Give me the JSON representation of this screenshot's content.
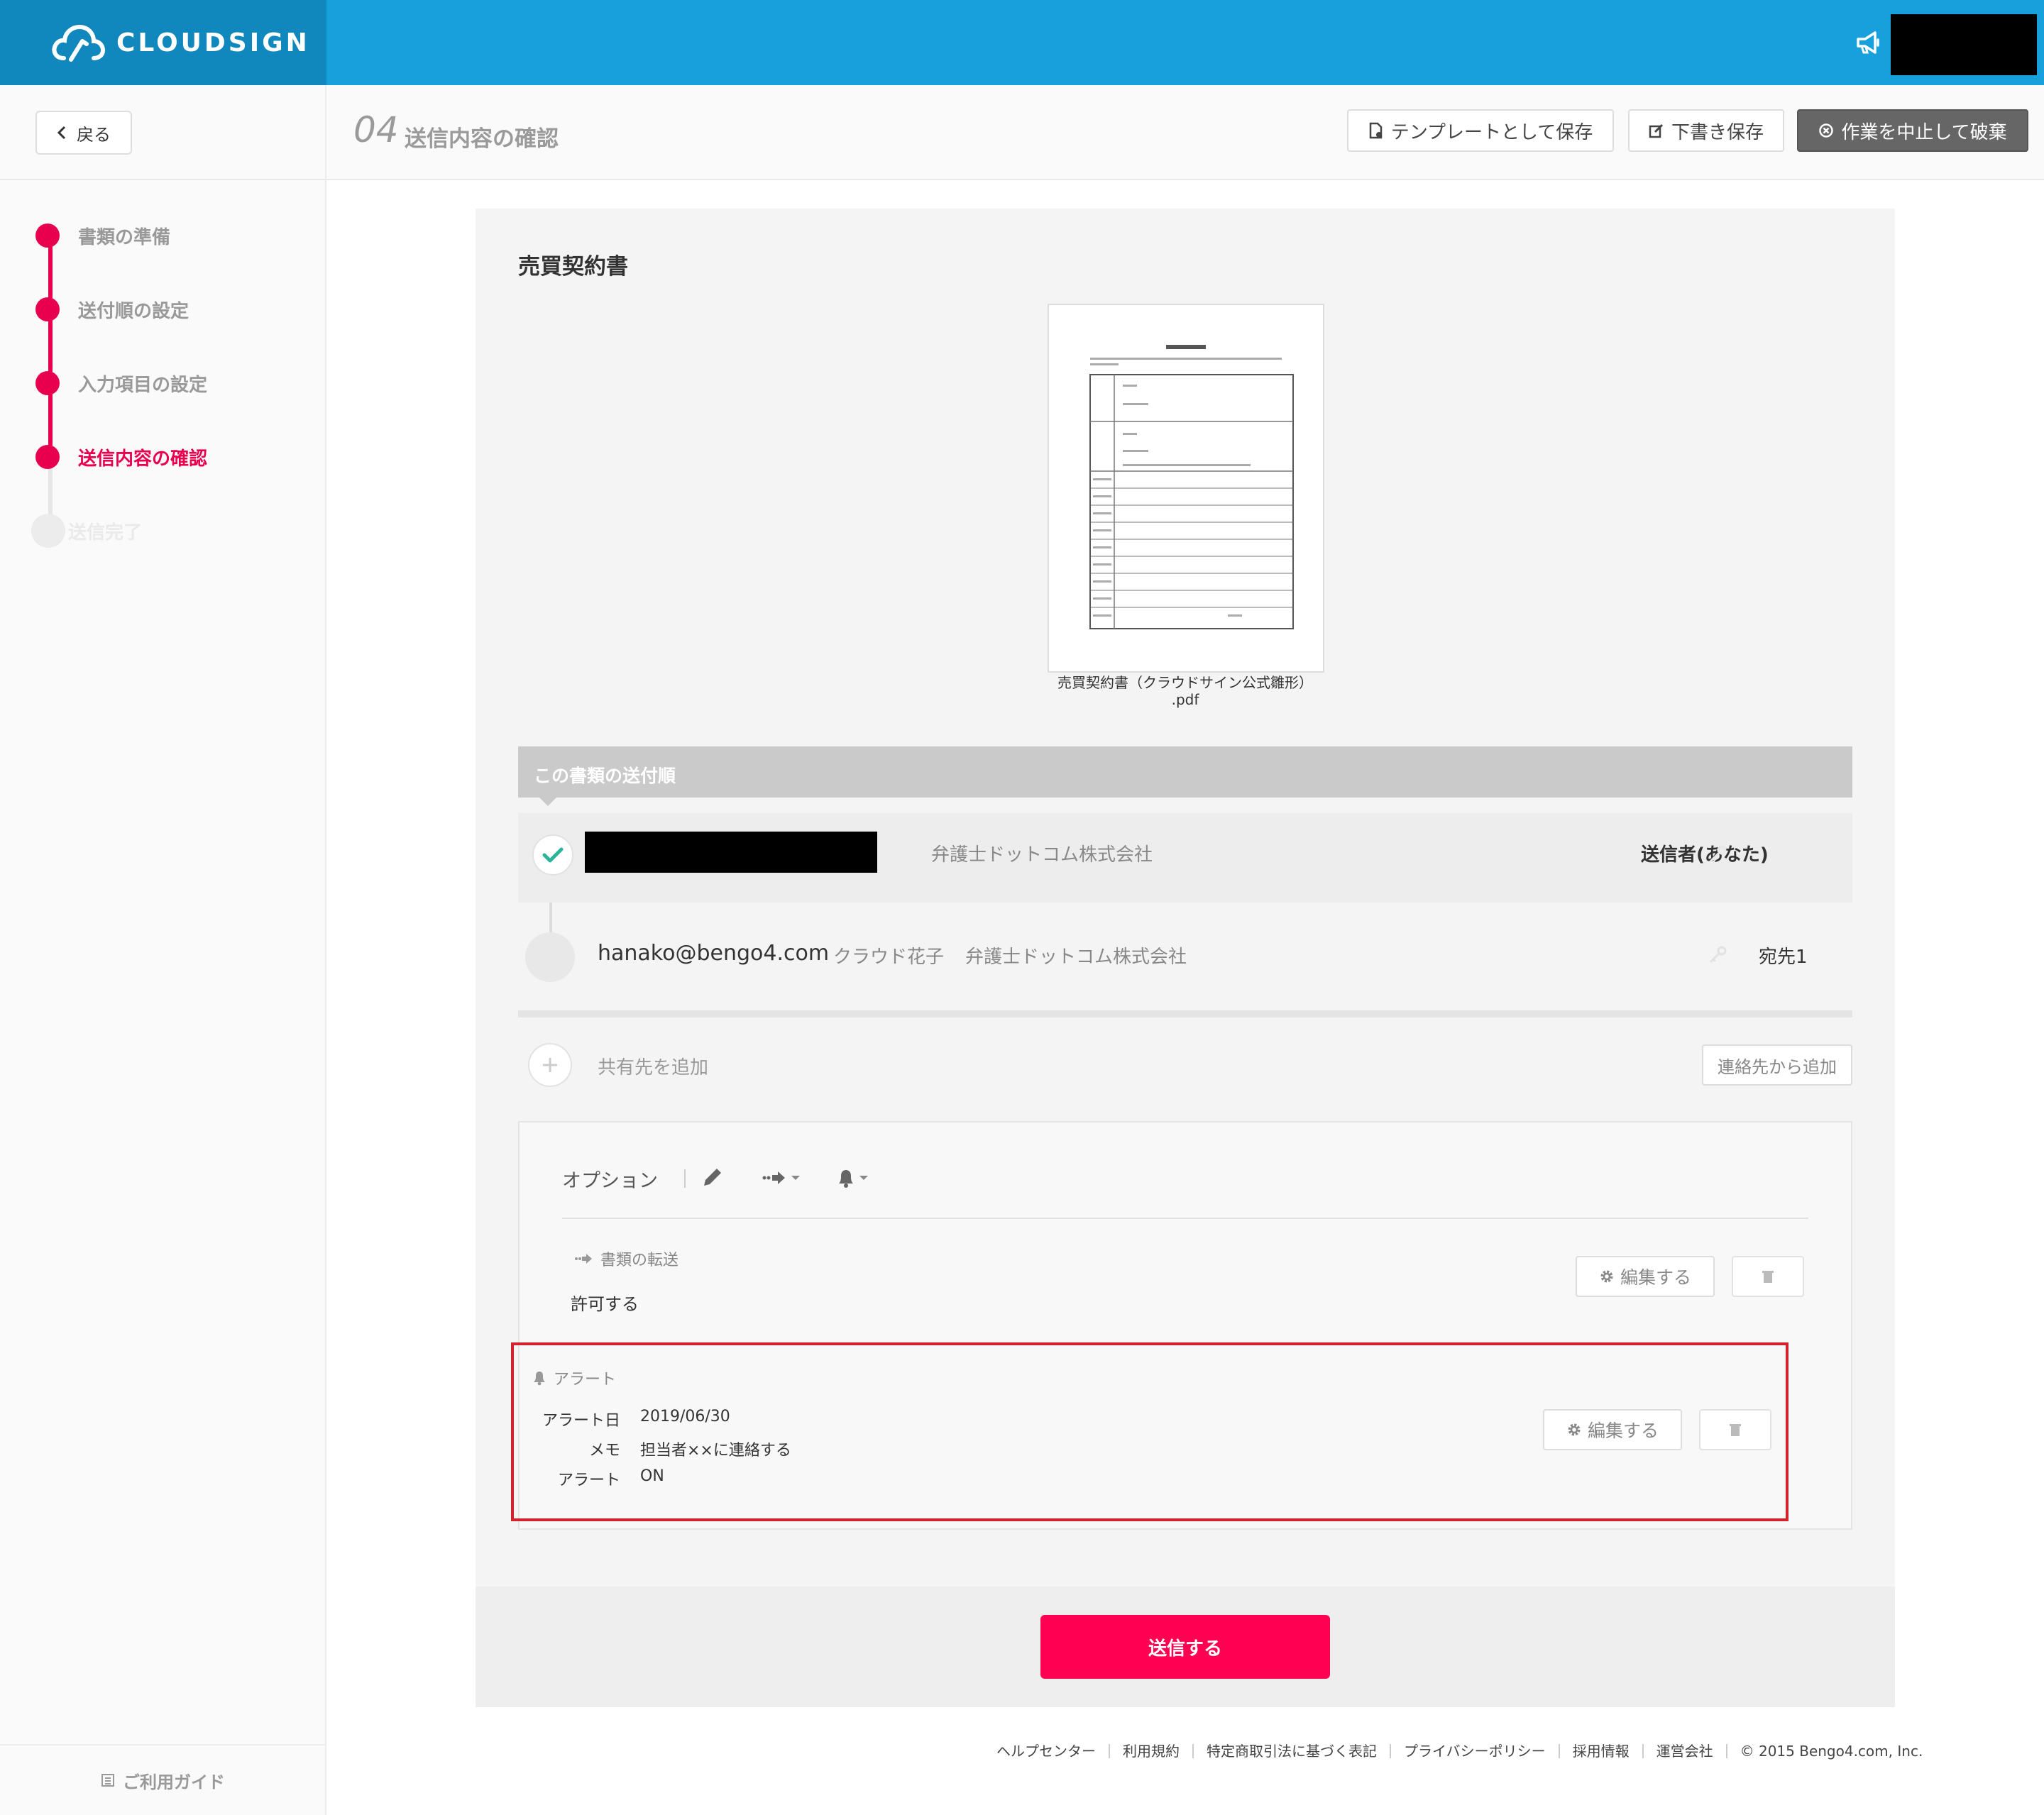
{
  "colors": {
    "brand": "#17a0dc",
    "accent": "#e8004f",
    "send": "#ff0052",
    "highlight": "#d2232a"
  },
  "header": {
    "logo": "CLOUDSIGN",
    "announce_icon": "megaphone-icon"
  },
  "subheader": {
    "back_label": "戻る",
    "step_number": "04",
    "step_title": "送信内容の確認",
    "template_save_label": "テンプレートとして保存",
    "draft_save_label": "下書き保存",
    "discard_label": "作業を中止して破棄"
  },
  "sidebar": {
    "steps": [
      {
        "label": "書類の準備",
        "state": "done"
      },
      {
        "label": "送付順の設定",
        "state": "done"
      },
      {
        "label": "入力項目の設定",
        "state": "done"
      },
      {
        "label": "送信内容の確認",
        "state": "current"
      },
      {
        "label": "送信完了",
        "state": "pending"
      }
    ],
    "guide_label": "ご利用ガイド"
  },
  "document": {
    "title": "売買契約書",
    "filename": "売買契約書（クラウドサイン公式雛形）\n.pdf"
  },
  "order": {
    "header_label": "この書類の送付順",
    "sender": {
      "company": "弁護士ドットコム株式会社",
      "role": "送信者(あなた)"
    },
    "recipient": {
      "email": "hanako@bengo4.com",
      "name": "クラウド花子",
      "company": "弁護士ドットコム株式会社",
      "role": "宛先1"
    }
  },
  "share": {
    "add_label": "共有先を追加",
    "from_contacts_label": "連絡先から追加"
  },
  "options": {
    "label": "オプション",
    "forward": {
      "title": "書類の転送",
      "value": "許可する",
      "edit_label": "編集する"
    },
    "alert": {
      "title": "アラート",
      "rows": [
        {
          "key": "アラート日",
          "value": "2019/06/30"
        },
        {
          "key": "メモ",
          "value": "担当者××に連絡する"
        },
        {
          "key": "アラート",
          "value": "ON"
        }
      ],
      "edit_label": "編集する"
    }
  },
  "send_label": "送信する",
  "footer": {
    "links": [
      "ヘルプセンター",
      "利用規約",
      "特定商取引法に基づく表記",
      "プライバシーポリシー",
      "採用情報",
      "運営会社"
    ],
    "copyright": "© 2015 Bengo4.com, Inc."
  }
}
